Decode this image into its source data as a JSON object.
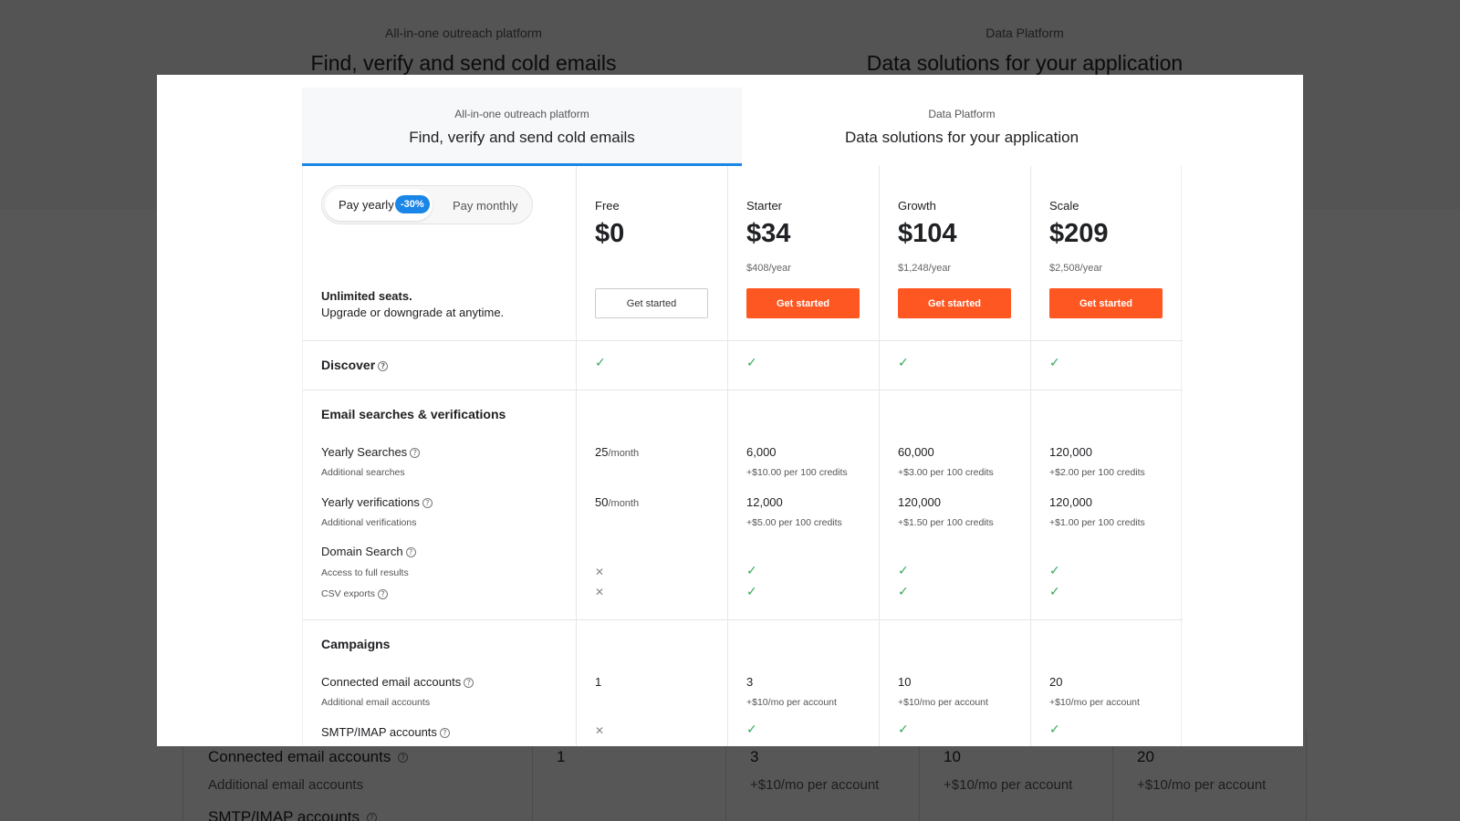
{
  "tabs": [
    {
      "kicker": "All-in-one outreach platform",
      "title": "Find, verify and send cold emails"
    },
    {
      "kicker": "Data Platform",
      "title": "Data solutions for your application"
    }
  ],
  "billing": {
    "yearly": "Pay yearly",
    "discount": "-30%",
    "monthly": "Pay monthly"
  },
  "seats": {
    "bold": "Unlimited seats.",
    "text": "Upgrade or downgrade at anytime."
  },
  "help_glyph": "?",
  "check_glyph": "✓",
  "cross_glyph": "✕",
  "plans": [
    {
      "name": "Free",
      "price": "$0",
      "year": "",
      "cta": "Get started",
      "style": "ghost"
    },
    {
      "name": "Starter",
      "price": "$34",
      "year": "$408/year",
      "cta": "Get started",
      "style": "primary"
    },
    {
      "name": "Growth",
      "price": "$104",
      "year": "$1,248/year",
      "cta": "Get started",
      "style": "primary"
    },
    {
      "name": "Scale",
      "price": "$209",
      "year": "$2,508/year",
      "cta": "Get started",
      "style": "primary"
    }
  ],
  "discover": {
    "label": "Discover"
  },
  "email_section": {
    "title": "Email searches & verifications",
    "yearly_searches": {
      "label": "Yearly Searches",
      "sub": "Additional searches",
      "values": [
        "25",
        "6,000",
        "60,000",
        "120,000"
      ],
      "free_unit": "/month",
      "extras": [
        "+$10.00 per 100 credits",
        "+$3.00 per 100 credits",
        "+$2.00 per 100 credits"
      ]
    },
    "yearly_verifications": {
      "label": "Yearly verifications",
      "sub": "Additional verifications",
      "values": [
        "50",
        "12,000",
        "120,000",
        "120,000"
      ],
      "free_unit": "/month",
      "extras": [
        "+$5.00 per 100 credits",
        "+$1.50 per 100 credits",
        "+$1.00 per 100 credits"
      ]
    },
    "domain_search": {
      "label": "Domain Search",
      "full_results": "Access to full results",
      "csv": "CSV exports"
    }
  },
  "campaigns": {
    "title": "Campaigns",
    "connected": {
      "label": "Connected email accounts",
      "sub": "Additional email accounts",
      "values": [
        "1",
        "3",
        "10",
        "20"
      ],
      "extras": [
        "+$10/mo per account",
        "+$10/mo per account",
        "+$10/mo per account"
      ]
    },
    "smtp": {
      "label": "SMTP/IMAP accounts"
    }
  },
  "colors": {
    "accent": "#1a86e8",
    "cta": "#ff5722",
    "check": "#36a85a"
  }
}
